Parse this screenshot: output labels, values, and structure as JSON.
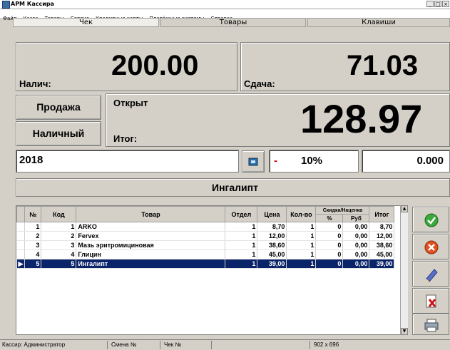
{
  "window": {
    "title": "АРМ Кассира",
    "min_label": "_",
    "max_label": "□",
    "close_label": "×"
  },
  "menu": [
    "Файл",
    "Касса",
    "Товары",
    "Сервис",
    "Кредитные карты",
    "Платёжные системы",
    "Справка"
  ],
  "tabs": [
    {
      "label": "Чек",
      "active": true
    },
    {
      "label": "Товары",
      "active": false
    },
    {
      "label": "Клавиши",
      "active": false
    }
  ],
  "cash": {
    "label": "Налич:",
    "value": "200.00"
  },
  "change": {
    "label": "Сдача:",
    "value": "71.03"
  },
  "buttons": {
    "sale": "Продажа",
    "cash_type": "Наличный"
  },
  "status_open": "Открыт",
  "total": {
    "label": "Итог:",
    "value": "128.97"
  },
  "input": {
    "value": "2018"
  },
  "discount": {
    "sign": "-",
    "percent": "10%",
    "amount": "0.000"
  },
  "current_item": "Ингалипт",
  "grid": {
    "headers": {
      "num": "№",
      "code": "Код",
      "item": "Товар",
      "dept": "Отдел",
      "price": "Цена",
      "qty": "Кол-во",
      "disc_group": "Скидка/Наценка",
      "disc_pct": "%",
      "disc_rub": "Руб",
      "total": "Итог"
    },
    "rows": [
      {
        "num": "1",
        "code": "1",
        "item": "ARKO",
        "dept": "1",
        "price": "8,70",
        "qty": "1",
        "pct": "0",
        "rub": "0,00",
        "total": "8,70",
        "selected": false
      },
      {
        "num": "2",
        "code": "2",
        "item": "Fervex",
        "dept": "1",
        "price": "12,00",
        "qty": "1",
        "pct": "0",
        "rub": "0,00",
        "total": "12,00",
        "selected": false
      },
      {
        "num": "3",
        "code": "3",
        "item": "Мазь эритромициновая",
        "dept": "1",
        "price": "38,60",
        "qty": "1",
        "pct": "0",
        "rub": "0,00",
        "total": "38,60",
        "selected": false
      },
      {
        "num": "4",
        "code": "4",
        "item": "Глицин",
        "dept": "1",
        "price": "45,00",
        "qty": "1",
        "pct": "0",
        "rub": "0,00",
        "total": "45,00",
        "selected": false
      },
      {
        "num": "5",
        "code": "5",
        "item": "Ингалипт",
        "dept": "1",
        "price": "39,00",
        "qty": "1",
        "pct": "0",
        "rub": "0,00",
        "total": "39,00",
        "selected": true
      }
    ]
  },
  "side_buttons": [
    "check-icon",
    "cancel-icon",
    "edit-icon",
    "delete-icon",
    "print-icon"
  ],
  "statusbar": {
    "cashier": "Кассир: Администратор",
    "shift": "Смена №",
    "check": "Чек №",
    "resolution": "902 x 696"
  },
  "colors": {
    "selected_row": "#0a246a",
    "discount_sign": "#cc0000"
  }
}
